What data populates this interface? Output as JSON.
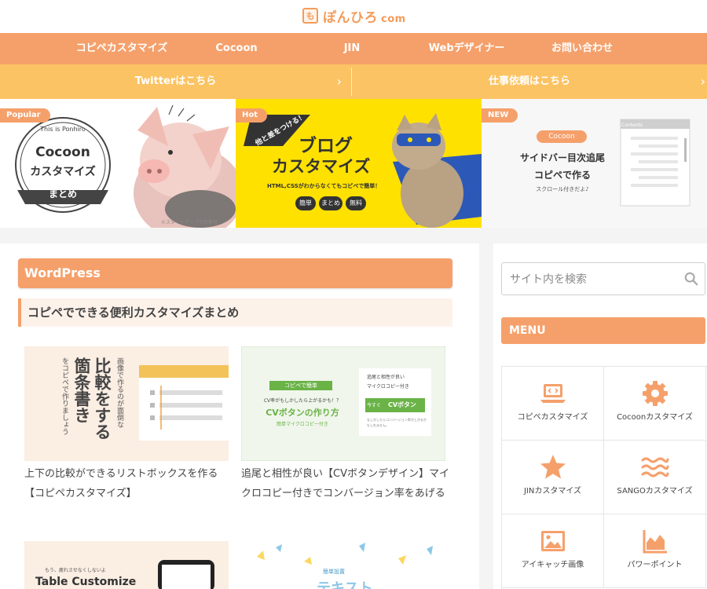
{
  "header": {
    "logo_mark": "も",
    "logo_text": "ぽんひろ",
    "logo_suffix": "com"
  },
  "nav": {
    "items": [
      {
        "label": "コピペカスタマイズ"
      },
      {
        "label": "Cocoon"
      },
      {
        "label": "JIN"
      },
      {
        "label": "Webデザイナー"
      },
      {
        "label": "お問い合わせ"
      }
    ]
  },
  "subnav": {
    "left": "Twitterはこちら",
    "right": "仕事依頼はこちら"
  },
  "banners": [
    {
      "badge": "Popular",
      "badge_color": "#f5a06b",
      "small_text": "This is Ponhiro",
      "title": "Cocoon",
      "subtitle": "カスタマイズ",
      "ribbon": "まとめ",
      "caption": "©スタートアップ写真素材"
    },
    {
      "badge": "Hot",
      "badge_color": "#f5a06b",
      "tag": "他と差をつける！",
      "title_line1": "ブログ",
      "title_line2": "カスタマイズ",
      "desc": "HTML,CSSがわからなくてもコピペで簡単！",
      "chips": [
        "簡単",
        "まとめ",
        "無料"
      ]
    },
    {
      "badge": "NEW",
      "badge_color": "#f5a06b",
      "pill": "Cocoon",
      "title_line1": "サイドバー目次追尾",
      "title_line2": "コピペで作る",
      "desc": "スクロール付きだよ♪",
      "panel_title": "Contents"
    }
  ],
  "main": {
    "category_title": "WordPress",
    "sub_heading": "コピペでできる便利カスタマイズまとめ",
    "posts": [
      {
        "title": "上下の比較ができるリストボックスを作る【コピペカスタマイズ】",
        "thumb_big": "比較をする",
        "thumb_big2": "箇条書き",
        "thumb_small": "画像で作るのが面倒な",
        "thumb_small2": "をコピペで作りましょう"
      },
      {
        "title": "追尾と相性が良い【CVボタンデザイン】マイクロコピー付きでコンバージョン率をあげる",
        "thumb_tag": "コピペで簡単",
        "thumb_q": "CV率がもしかしたら上がるかも！？",
        "thumb_head": "CVボタンの作り方",
        "thumb_sub": "簡単マイクロコピー付き",
        "thumb_check1": "追尾と相性が良い",
        "thumb_check2": "マイクロコピー付き",
        "thumb_btn": "CVボタン",
        "thumb_btn_tag": "今すぐ",
        "thumb_note": "なしかしたらコンバージョン率が上がるかもしれません。"
      },
      {
        "title": "",
        "thumb_small": "もう、疲れさせなくしないよ",
        "thumb_big": "Table Customize"
      },
      {
        "title": "",
        "thumb_small": "簡単設置",
        "thumb_big": "テキスト"
      }
    ]
  },
  "sidebar": {
    "search_placeholder": "サイト内を検索",
    "menu_title": "MENU",
    "menu_items": [
      {
        "label": "コピペカスタマイズ",
        "icon": "laptop-code-icon"
      },
      {
        "label": "Cocoonカスタマイズ",
        "icon": "gear-icon"
      },
      {
        "label": "JINカスタマイズ",
        "icon": "star-icon"
      },
      {
        "label": "SANGOカスタマイズ",
        "icon": "waves-icon"
      },
      {
        "label": "アイキャッチ画像",
        "icon": "image-icon"
      },
      {
        "label": "パワーポイント",
        "icon": "chart-icon"
      }
    ]
  },
  "colors": {
    "accent": "#f5a06b",
    "sub_accent": "#fbc363",
    "banner_yellow": "#ffe100"
  }
}
